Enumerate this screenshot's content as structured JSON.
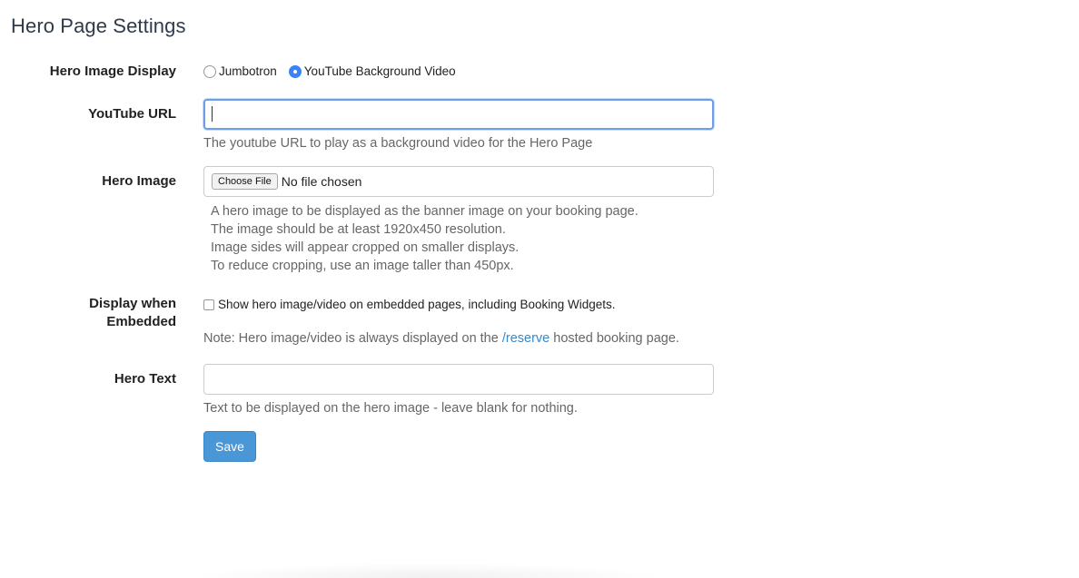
{
  "page": {
    "title": "Hero Page Settings"
  },
  "hero_image_display": {
    "label": "Hero Image Display",
    "options": [
      {
        "label": "Jumbotron",
        "checked": false
      },
      {
        "label": "YouTube Background Video",
        "checked": true
      }
    ]
  },
  "youtube_url": {
    "label": "YouTube URL",
    "value": "",
    "help": "The youtube URL to play as a background video for the Hero Page"
  },
  "hero_image": {
    "label": "Hero Image",
    "button_label": "Choose File",
    "status": "No file chosen",
    "help_lines": [
      "A hero image to be displayed as the banner image on your booking page.",
      "The image should be at least 1920x450 resolution.",
      "Image sides will appear cropped on smaller displays.",
      "To reduce cropping, use an image taller than 450px."
    ]
  },
  "display_embedded": {
    "label_line1": "Display when",
    "label_line2": "Embedded",
    "checkbox_label": "Show hero image/video on embedded pages, including Booking Widgets.",
    "checked": false,
    "note_prefix": "Note: Hero image/video is always displayed on the ",
    "note_link": "/reserve",
    "note_suffix": " hosted booking page."
  },
  "hero_text": {
    "label": "Hero Text",
    "value": "",
    "help": "Text to be displayed on the hero image - leave blank for nothing."
  },
  "actions": {
    "save_label": "Save"
  },
  "colors": {
    "accent": "#4a97d8",
    "link": "#3a87c8",
    "radio_selected": "#3b82f6",
    "focus_border": "#6f9ee9"
  }
}
